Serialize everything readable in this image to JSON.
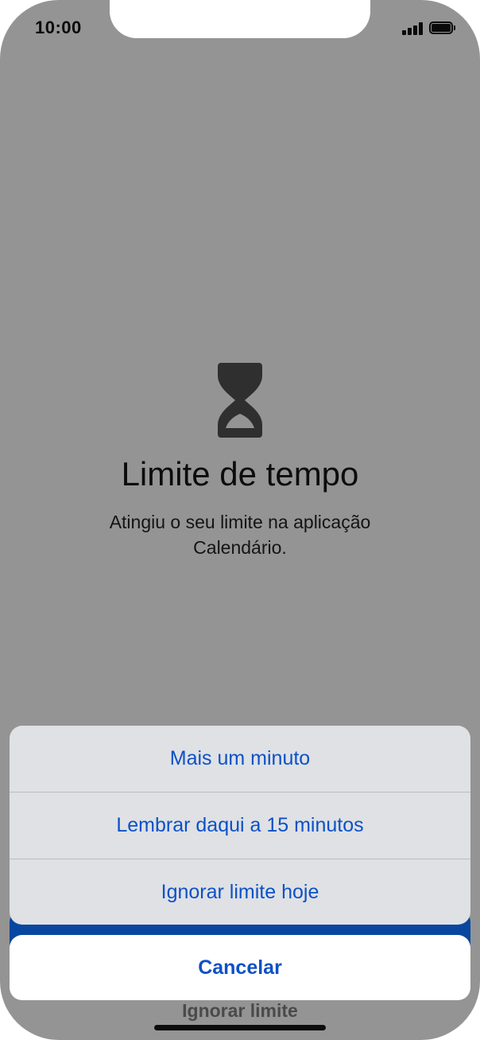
{
  "status_bar": {
    "time": "10:00",
    "signal_icon": "cellular-signal-icon",
    "battery_icon": "battery-icon"
  },
  "screen": {
    "icon": "hourglass-icon",
    "title": "Limite de tempo",
    "message": "Atingiu o seu limite na aplicação Calendário.",
    "hidden_button_label": "Ignorar limite"
  },
  "action_sheet": {
    "actions": [
      {
        "label": "Mais um minuto"
      },
      {
        "label": "Lembrar daqui a 15 minutos"
      },
      {
        "label": "Ignorar limite hoje"
      }
    ],
    "cancel_label": "Cancelar"
  },
  "colors": {
    "overlay": "#949494",
    "action_text": "#0c51c6",
    "sheet_background": "#dfe1e5",
    "hidden_button": "#0846a0"
  }
}
